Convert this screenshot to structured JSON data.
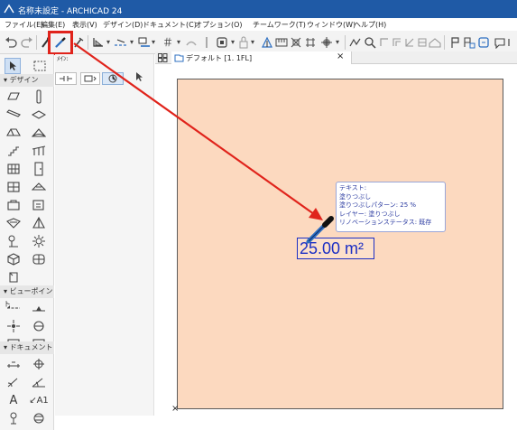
{
  "window": {
    "title": "名称未設定 - ARCHICAD 24"
  },
  "menubar": {
    "items": [
      "ファイル(E)",
      "編集(E)",
      "表示(V)",
      "デザイン(D)",
      "ドキュメント(C)",
      "オプション(O)",
      "チームワーク(T)",
      "ウィンドウ(W)",
      "ヘルプ(H)"
    ]
  },
  "toolbar": {
    "icons": [
      "undo-icon",
      "redo-icon",
      "pipette-icon",
      "eyedropper-inject-icon",
      "layer-icon",
      "line-type-icon",
      "pen-icon",
      "grid-icon",
      "gravity-icon",
      "wall-icon",
      "view-icon",
      "snap-icon",
      "measure-icon",
      "ruler-icon",
      "find-icon",
      "render-icon"
    ]
  },
  "palette": {
    "sections": {
      "design": "デザイン",
      "viewpoint": "ビューポイント",
      "document": "ドキュメント"
    },
    "text_tool": "A",
    "label_tool": "A1"
  },
  "infobox": {
    "label": "ﾒｲﾝ:"
  },
  "tab": {
    "label": "デフォルト [1. 1FL]",
    "close": "×"
  },
  "zone": {
    "area_label": "25.00 m²"
  },
  "tooltip": {
    "lines": [
      "テキスト:",
      "塗りつぶし",
      "塗りつぶしパターン: 25 %",
      "レイヤー: 塗りつぶし",
      "リノベーションステータス: 既存"
    ]
  },
  "colors": {
    "titlebar": "#1f5aa6",
    "slab_fill": "#fcd9bf",
    "annotation_red": "#e0231b",
    "label_blue": "#1c2fc4"
  }
}
